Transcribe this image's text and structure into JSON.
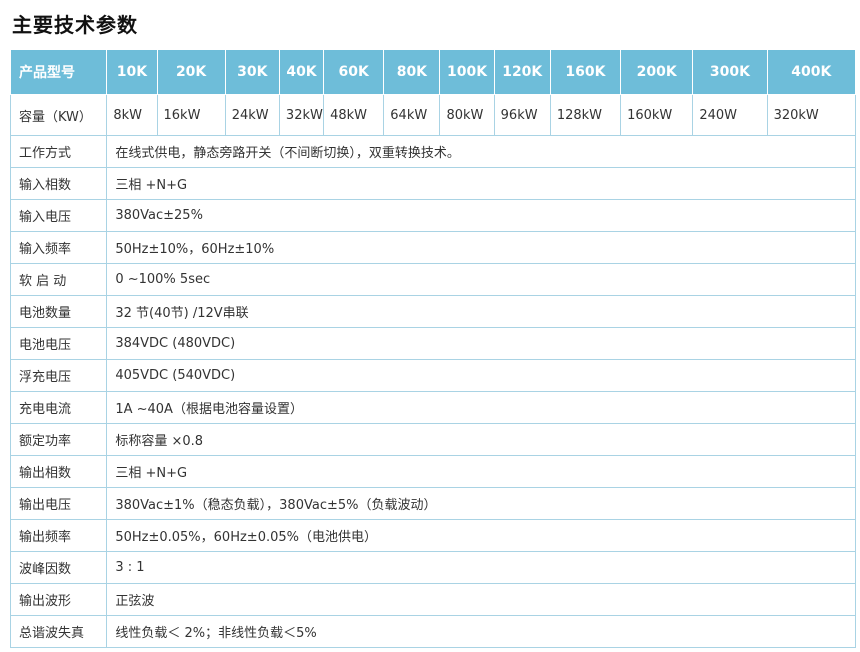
{
  "title": "主要技术参数",
  "header": {
    "label": "产品型号",
    "models": [
      "10K",
      "20K",
      "30K",
      "40K",
      "60K",
      "80K",
      "100K",
      "120K",
      "160K",
      "200K",
      "300K",
      "400K"
    ]
  },
  "capacity": {
    "label": "容量（KW）",
    "values": [
      "8kW",
      "16kW",
      "24kW",
      "32kW",
      "48kW",
      "64kW",
      "80kW",
      "96kW",
      "128kW",
      "160kW",
      "240W",
      "320kW"
    ]
  },
  "rows": [
    {
      "label": "工作方式",
      "value": "在线式供电，静态旁路开关（不间断切换），双重转换技术。"
    },
    {
      "label": "输入相数",
      "value": "三相 +N+G"
    },
    {
      "label": "输入电压",
      "value": "380Vac±25%"
    },
    {
      "label": "输入频率",
      "value": "50Hz±10%，60Hz±10%"
    },
    {
      "label": "软 启 动",
      "value": "0 ~100% 5sec"
    },
    {
      "label": "电池数量",
      "value": "32 节(40节) /12V串联"
    },
    {
      "label": "电池电压",
      "value": "384VDC (480VDC)"
    },
    {
      "label": "浮充电压",
      "value": "405VDC  (540VDC)"
    },
    {
      "label": "充电电流",
      "value": "1A ~40A（根据电池容量设置）"
    },
    {
      "label": "额定功率",
      "value": "标称容量 ×0.8"
    },
    {
      "label": "输出相数",
      "value": "三相 +N+G"
    },
    {
      "label": "输出电压",
      "value": "380Vac±1%（稳态负载），380Vac±5%（负载波动）"
    },
    {
      "label": "输出频率",
      "value": "50Hz±0.05%，60Hz±0.05%（电池供电）"
    },
    {
      "label": "波峰因数",
      "value": "3 : 1"
    },
    {
      "label": "输出波形",
      "value": "正弦波"
    },
    {
      "label": "总谐波失真",
      "value": "线性负载＜ 2%；非线性负载＜5%"
    }
  ]
}
